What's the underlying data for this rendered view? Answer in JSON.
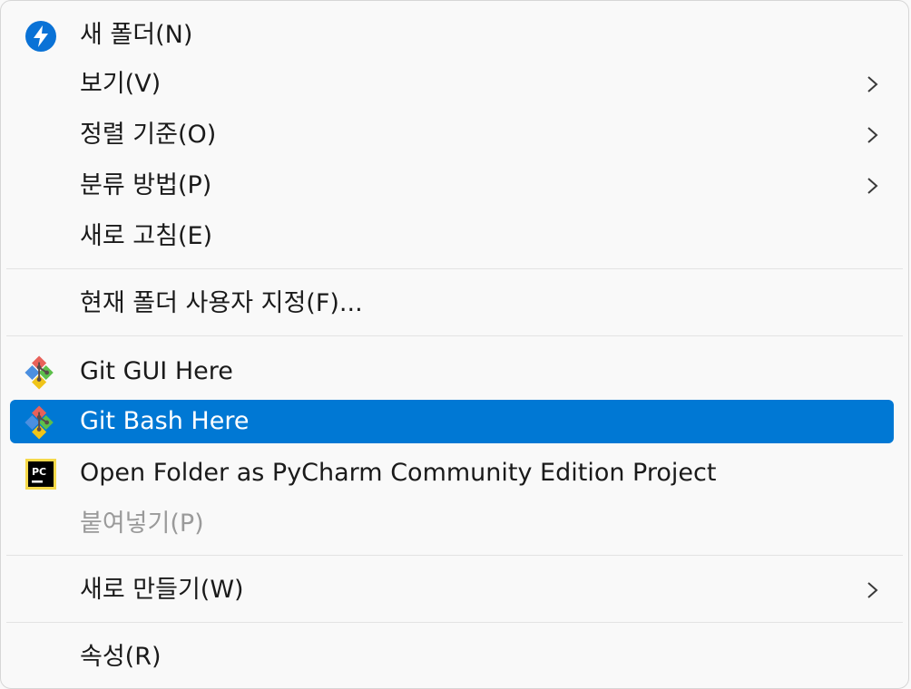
{
  "menu": {
    "items": [
      {
        "label": "새 폴더(N)",
        "icon": "bolt-icon"
      },
      {
        "label": "보기(V)"
      },
      {
        "label": "정렬 기준(O)"
      },
      {
        "label": "분류 방법(P)"
      },
      {
        "label": "새로 고침(E)"
      },
      {
        "label": "현재 폴더 사용자 지정(F)..."
      },
      {
        "label": "Git GUI Here",
        "icon": "git-icon"
      },
      {
        "label": "Git Bash Here",
        "icon": "git-icon",
        "state": "highlighted"
      },
      {
        "label": "Open Folder as PyCharm Community Edition Project",
        "icon": "pycharm-icon"
      },
      {
        "label": "붙여넣기(P)",
        "state": "disabled"
      },
      {
        "label": "새로 만들기(W)"
      },
      {
        "label": "속성(R)"
      }
    ],
    "pycharm_icon_text": "PC"
  },
  "colors": {
    "highlight": "#0078d4",
    "disabled_text": "#9a9a9a",
    "bolt_circle": "#0a72d6",
    "pycharm_yellow": "#f5d94a"
  }
}
